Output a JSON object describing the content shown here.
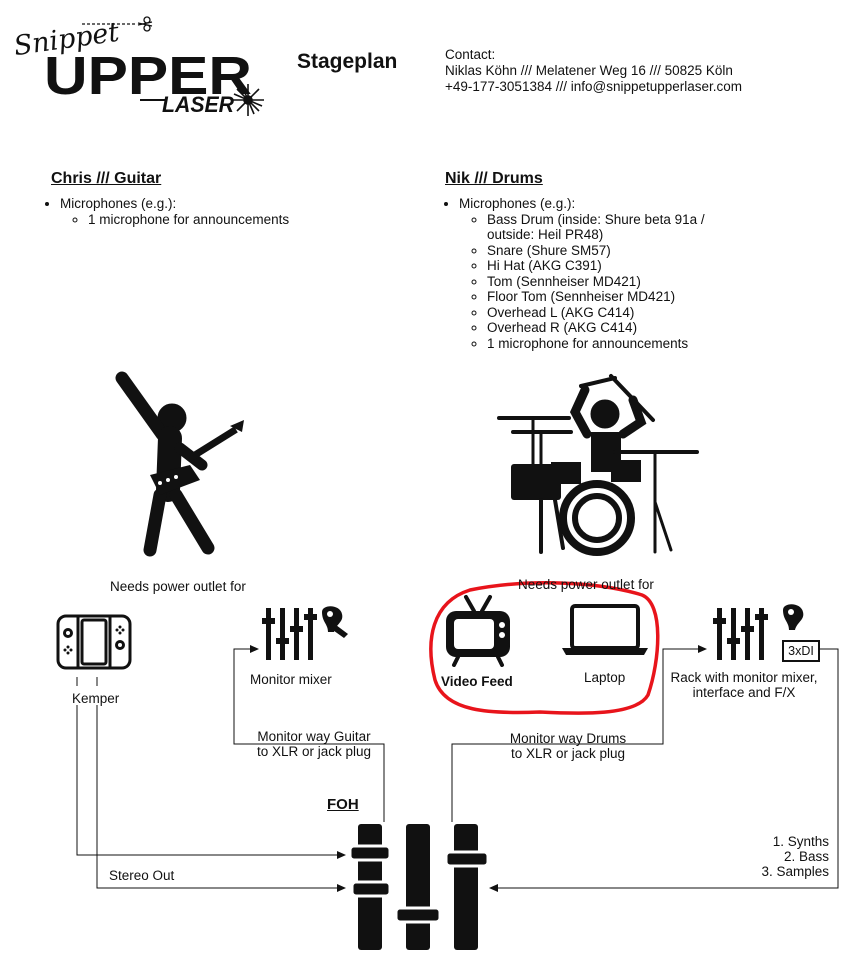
{
  "logo": {
    "line1": "Snippet",
    "line2": "UPPER",
    "line3": "LASER"
  },
  "title": "Stageplan",
  "contact": {
    "heading": "Contact:",
    "line1": "Niklas Köhn /// Melatener Weg 16 /// 50825 Köln",
    "line2": "+49-177-3051384 /// info@snippetupperlaser.com"
  },
  "chris": {
    "heading": "Chris /// Guitar",
    "mic_label": "Microphones (e.g.):",
    "mics": [
      "1 microphone for announcements"
    ]
  },
  "nik": {
    "heading": "Nik /// Drums",
    "mic_label": "Microphones (e.g.):",
    "mics": [
      "Bass Drum (inside: Shure beta 91a /",
      "outside: Heil PR48)",
      "Snare (Shure SM57)",
      "Hi Hat (AKG C391)",
      "Tom (Sennheiser MD421)",
      "Floor Tom (Sennheiser MD421)",
      "Overhead L (AKG C414)",
      "Overhead R (AKG C414)",
      "1 microphone for announcements"
    ]
  },
  "labels": {
    "power_left": "Needs power outlet for",
    "power_right": "Needs power outlet for",
    "kemper": "Kemper",
    "monitor_mixer": "Monitor mixer",
    "video_feed": "Video Feed",
    "laptop": "Laptop",
    "rack_line1": "Rack with monitor mixer,",
    "rack_line2": "interface and F/X",
    "di": "3xDI",
    "monitor_guitar_line1": "Monitor way Guitar",
    "monitor_guitar_line2": "to XLR or jack plug",
    "monitor_drums_line1": "Monitor way Drums",
    "monitor_drums_line2": "to XLR or jack plug",
    "foh": "FOH",
    "stereo_out": "Stereo Out",
    "synth1": "1. Synths",
    "synth2": "2. Bass",
    "synth3": "3. Samples"
  },
  "colors": {
    "highlight": "#e8141b",
    "ink": "#111111"
  }
}
